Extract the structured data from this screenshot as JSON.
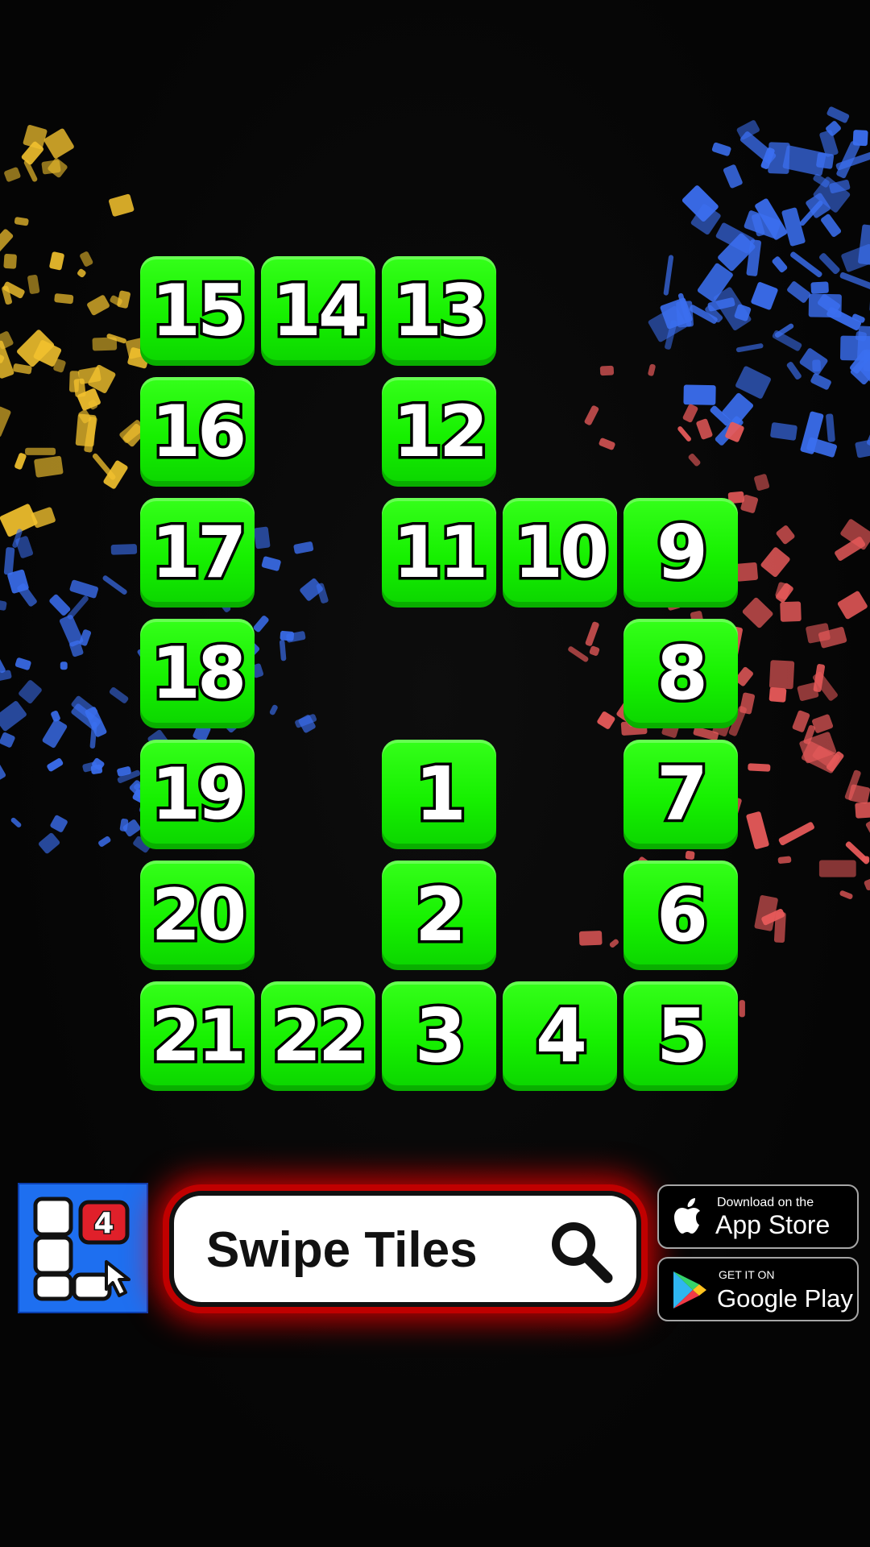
{
  "game": {
    "title": "Swipe Tiles",
    "board": {
      "cols": 5,
      "rows": 7,
      "tiles": [
        {
          "number": "15",
          "col": 0,
          "row": 0
        },
        {
          "number": "14",
          "col": 1,
          "row": 0
        },
        {
          "number": "13",
          "col": 2,
          "row": 0
        },
        {
          "number": "16",
          "col": 0,
          "row": 1
        },
        {
          "number": "12",
          "col": 2,
          "row": 1
        },
        {
          "number": "17",
          "col": 0,
          "row": 2
        },
        {
          "number": "11",
          "col": 2,
          "row": 2
        },
        {
          "number": "10",
          "col": 3,
          "row": 2
        },
        {
          "number": "9",
          "col": 4,
          "row": 2
        },
        {
          "number": "18",
          "col": 0,
          "row": 3
        },
        {
          "number": "8",
          "col": 4,
          "row": 3
        },
        {
          "number": "19",
          "col": 0,
          "row": 4
        },
        {
          "number": "1",
          "col": 2,
          "row": 4
        },
        {
          "number": "7",
          "col": 4,
          "row": 4
        },
        {
          "number": "20",
          "col": 0,
          "row": 5
        },
        {
          "number": "2",
          "col": 2,
          "row": 5
        },
        {
          "number": "6",
          "col": 4,
          "row": 5
        },
        {
          "number": "21",
          "col": 0,
          "row": 6
        },
        {
          "number": "22",
          "col": 1,
          "row": 6
        },
        {
          "number": "3",
          "col": 2,
          "row": 6
        },
        {
          "number": "4",
          "col": 3,
          "row": 6
        },
        {
          "number": "5",
          "col": 4,
          "row": 6
        }
      ]
    }
  },
  "banner": {
    "app_icon_badge": "4",
    "search_text": "Swipe Tiles",
    "app_store_small": "Download on the",
    "app_store_big": "App Store",
    "google_play_small": "GET IT ON",
    "google_play_big": "Google Play"
  },
  "colors": {
    "tile": "#16f000",
    "background": "#060606",
    "confetti_yellow": "#f2c12e",
    "confetti_blue": "#3b6ff0",
    "confetti_red": "#e85a5a",
    "glow": "#ff0000"
  }
}
